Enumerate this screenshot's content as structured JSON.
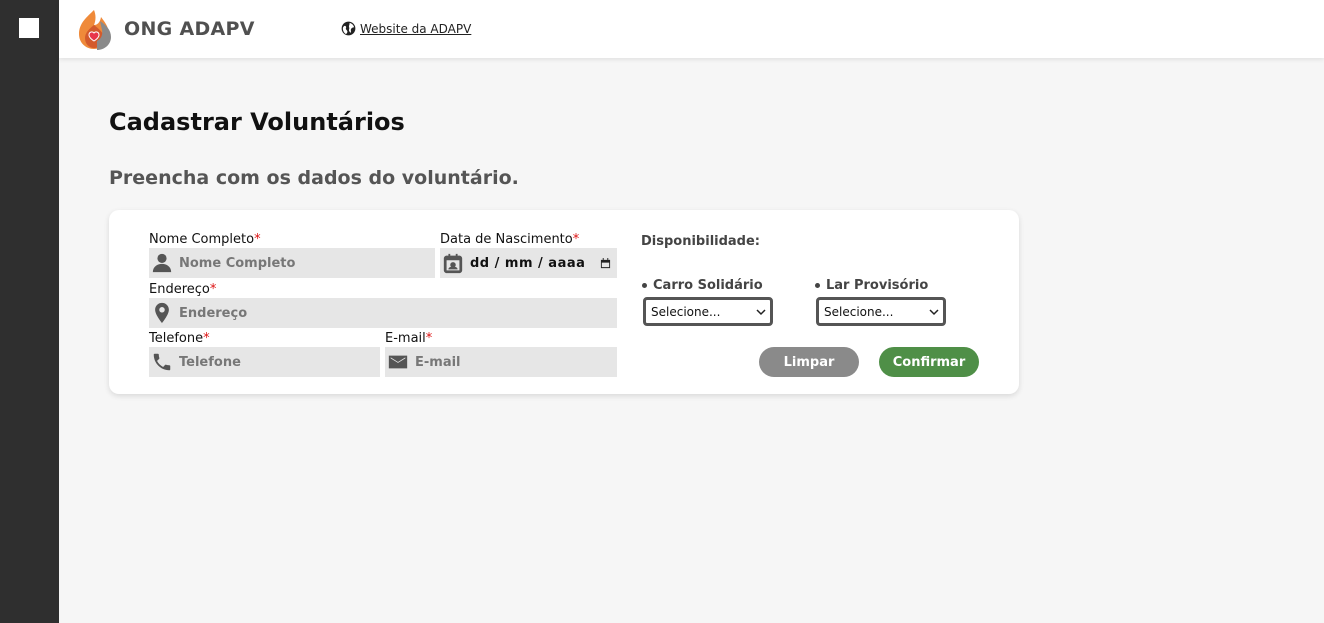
{
  "header": {
    "brand": "ONG ADAPV",
    "website_link": "Website da ADAPV"
  },
  "page": {
    "title": "Cadastrar Voluntários",
    "subtitle": "Preencha com os dados do voluntário."
  },
  "form": {
    "required_mark": "*",
    "nome": {
      "label": "Nome Completo",
      "placeholder": "Nome Completo",
      "icon": "person-icon"
    },
    "nascimento": {
      "label": "Data de Nascimento",
      "value": "dd / mm / aaaa",
      "icon": "calendar-icon"
    },
    "endereco": {
      "label": "Endereço",
      "placeholder": "Endereço",
      "icon": "location-pin-icon"
    },
    "telefone": {
      "label": "Telefone",
      "placeholder": "Telefone",
      "icon": "phone-icon"
    },
    "email": {
      "label": "E-mail",
      "placeholder": "E-mail",
      "icon": "envelope-icon"
    }
  },
  "disponibilidade": {
    "label": "Disponibilidade:",
    "carro": {
      "label": "Carro Solidário",
      "selected": "Selecione..."
    },
    "lar": {
      "label": "Lar Provisório",
      "selected": "Selecione..."
    }
  },
  "buttons": {
    "clear": "Limpar",
    "confirm": "Confirmar"
  },
  "colors": {
    "sidebar": "#2f2f2f",
    "confirm": "#4f8f47",
    "clear": "#8a8a8a",
    "required": "#dd1111"
  }
}
